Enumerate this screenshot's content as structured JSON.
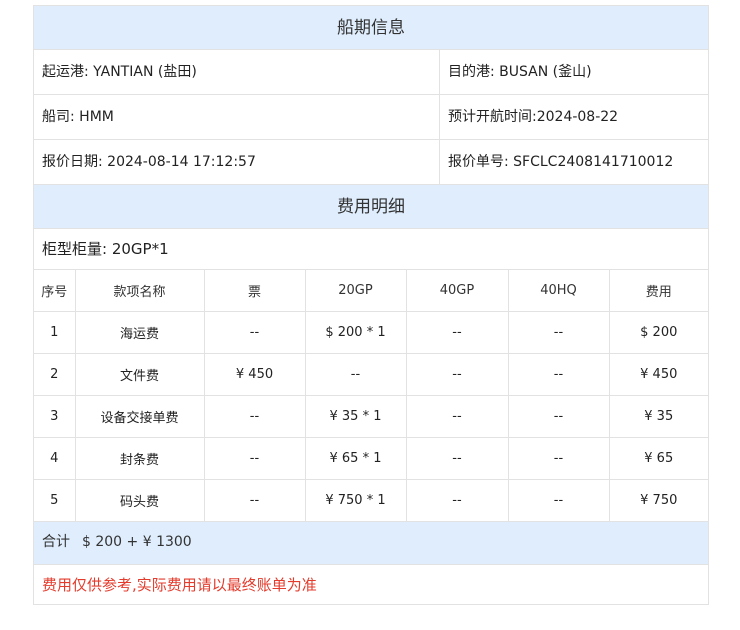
{
  "schedule": {
    "title": "船期信息",
    "origin_label": "起运港:",
    "origin_value": "YANTIAN (盐田)",
    "destination_label": "目的港:",
    "destination_value": "BUSAN (釜山)",
    "carrier_label": "船司:",
    "carrier_value": "HMM",
    "etd_label": "预计开航时间:",
    "etd_value": "2024-08-22",
    "quote_date_label": "报价日期:",
    "quote_date_value": "2024-08-14 17:12:57",
    "quote_no_label": "报价单号:",
    "quote_no_value": "SFCLC2408141710012"
  },
  "fees": {
    "title": "费用明细",
    "container_label": "柜型柜量:",
    "container_value": "20GP*1",
    "columns": [
      "序号",
      "款项名称",
      "票",
      "20GP",
      "40GP",
      "40HQ",
      "费用"
    ],
    "rows": [
      [
        "1",
        "海运费",
        "--",
        "$ 200 * 1",
        "--",
        "--",
        "$ 200"
      ],
      [
        "2",
        "文件费",
        "¥ 450",
        "--",
        "--",
        "--",
        "¥ 450"
      ],
      [
        "3",
        "设备交接单费",
        "--",
        "¥ 35 * 1",
        "--",
        "--",
        "¥ 35"
      ],
      [
        "4",
        "封条费",
        "--",
        "¥ 65 * 1",
        "--",
        "--",
        "¥ 65"
      ],
      [
        "5",
        "码头费",
        "--",
        "¥ 750 * 1",
        "--",
        "--",
        "¥ 750"
      ]
    ],
    "total_label": "合计",
    "total_value": "$ 200 + ¥ 1300",
    "disclaimer": "费用仅供参考,实际费用请以最终账单为准"
  },
  "colors": {
    "header_bg": "#dfedfd",
    "border": "#e2e2e2",
    "disclaimer": "#e33b2c"
  }
}
